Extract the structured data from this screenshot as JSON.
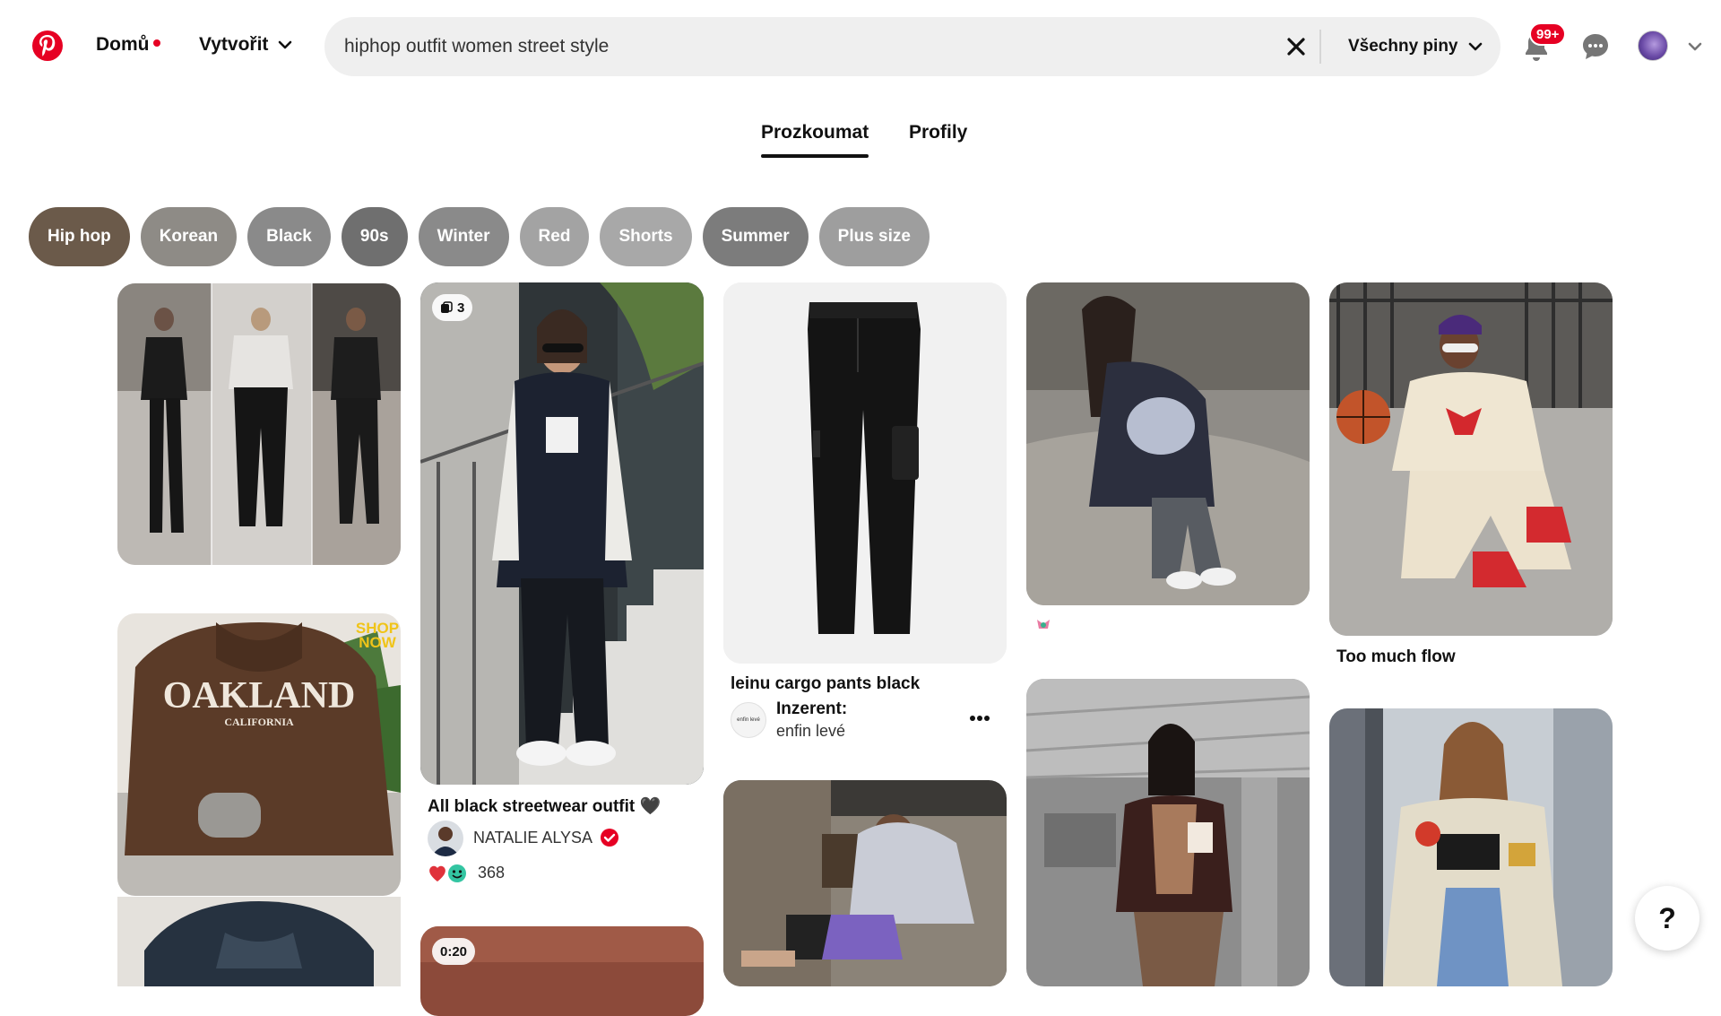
{
  "header": {
    "home_label": "Domů",
    "create_label": "Vytvořit",
    "search_value": "hiphop outfit women street style",
    "filter_label": "Všechny piny",
    "notifications_badge": "99+"
  },
  "tabs": [
    {
      "label": "Prozkoumat",
      "active": true
    },
    {
      "label": "Profily",
      "active": false
    }
  ],
  "chips": [
    {
      "label": "Hip hop",
      "color": "#6b5a4a"
    },
    {
      "label": "Korean",
      "color": "#8e8b86"
    },
    {
      "label": "Black",
      "color": "#8a8a8a"
    },
    {
      "label": "90s",
      "color": "#6f6f6f"
    },
    {
      "label": "Winter",
      "color": "#8a8a8a"
    },
    {
      "label": "Red",
      "color": "#a3a3a3"
    },
    {
      "label": "Shorts",
      "color": "#a8a8a8"
    },
    {
      "label": "Summer",
      "color": "#7c7c7c"
    },
    {
      "label": "Plus size",
      "color": "#9e9e9e"
    }
  ],
  "pins": {
    "p2": {
      "badge_count": "3",
      "title": "All black streetwear outfit 🖤",
      "author": "NATALIE ALYSA",
      "reactions": "368"
    },
    "p3": {
      "title": "leinu cargo pants black",
      "advertiser_label": "Inzerent:",
      "advertiser_name": "enfin levé",
      "advertiser_logo_text": "enfin levé"
    },
    "p5": {
      "title": "Too much flow"
    },
    "p6": {
      "shop_line1": "SHOP",
      "shop_line2": "NOW",
      "hoodie_text": "OAKLAND",
      "hoodie_sub": "CALIFORNIA"
    },
    "p8": {
      "video_duration": "0:20"
    }
  },
  "help_label": "?"
}
